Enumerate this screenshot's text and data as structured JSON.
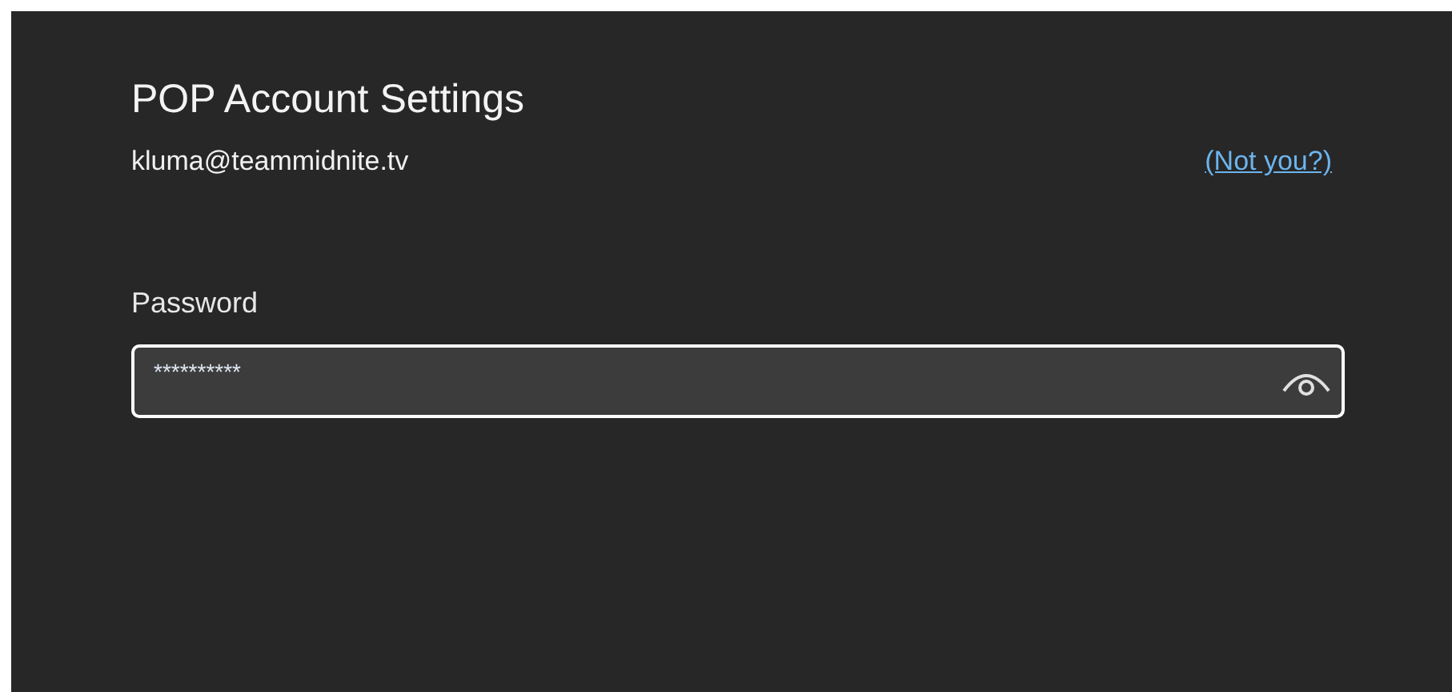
{
  "title": "POP Account Settings",
  "email": "kluma@teammidnite.tv",
  "not_you_link": "(Not you?)",
  "password": {
    "label": "Password",
    "value": "**********",
    "revealed": false
  }
}
